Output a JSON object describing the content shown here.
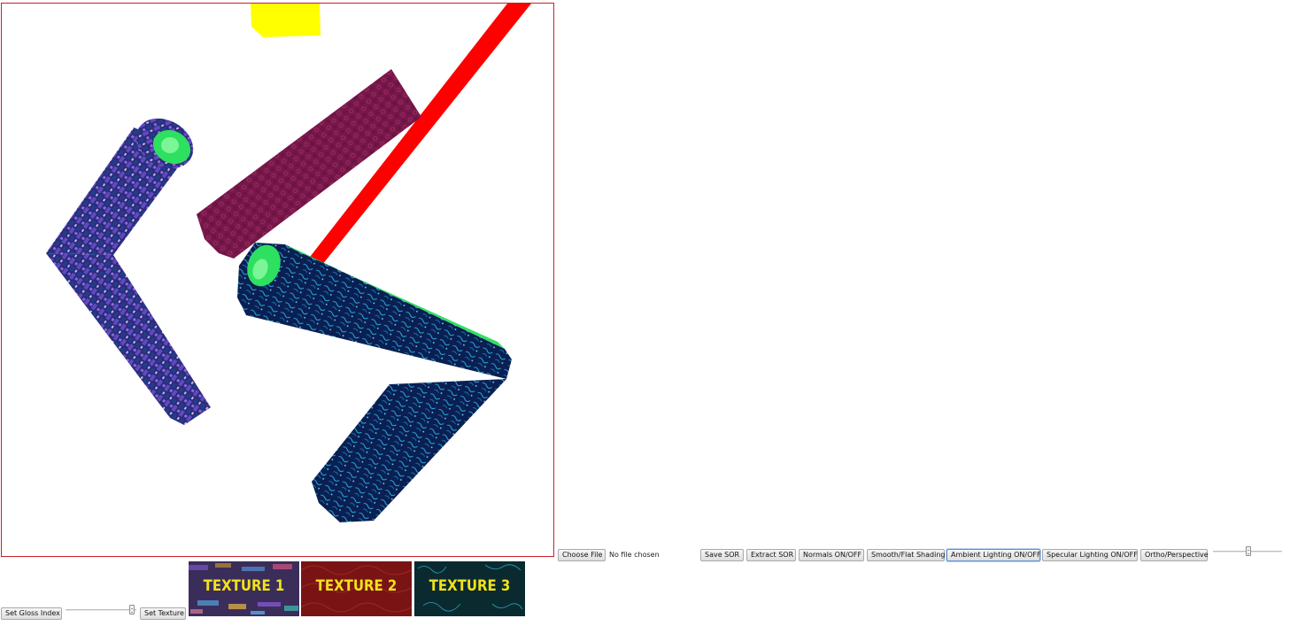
{
  "scene": {
    "colors": {
      "border": "#c8202a",
      "yellow_shape": "#ffff00",
      "red_bar": "#ff0000",
      "maroon_cylinder": "#7a1a4a",
      "green_cap": "#22e050",
      "purple_cylinder": "#3a2f86",
      "navy_cylinder": "#0b2257",
      "cyan_pattern": "#3ad6ff"
    }
  },
  "file_input": {
    "button_label": "Choose File",
    "status": "No file chosen"
  },
  "toolbar": {
    "save_sor": "Save SOR",
    "extract_sor": "Extract SOR",
    "normals": "Normals ON/OFF",
    "smooth_flat": "Smooth/Flat Shading",
    "ambient": "Ambient Lighting ON/OFF",
    "specular": "Specular Lighting ON/OFF",
    "ortho_perspective": "Ortho/Perspective"
  },
  "bottom": {
    "gloss_button": "Set Gloss Index",
    "texture_button": "Set Texture"
  },
  "textures": [
    {
      "label": "TEXTURE 1",
      "label_color": "#f2e21a",
      "bg": "#3b2d5a"
    },
    {
      "label": "TEXTURE 2",
      "label_color": "#f2e21a",
      "bg": "#7a1414"
    },
    {
      "label": "TEXTURE 3",
      "label_color": "#f2e21a",
      "bg": "#0a2a30"
    }
  ]
}
